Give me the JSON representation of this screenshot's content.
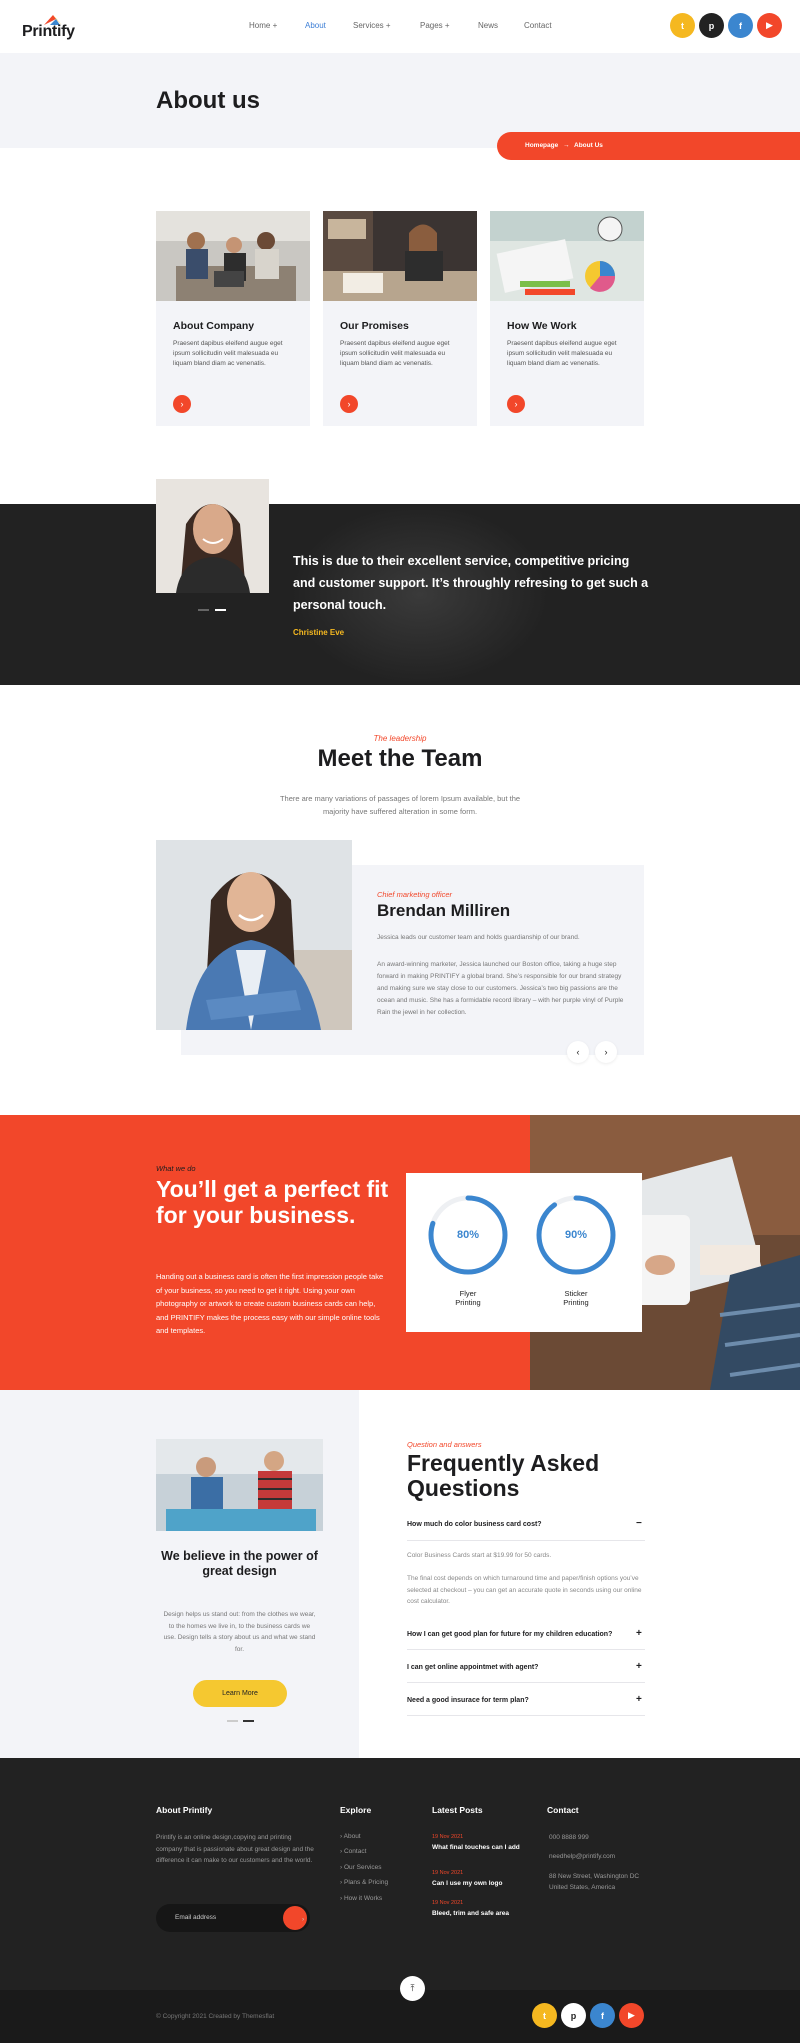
{
  "brand": {
    "name": "Printify"
  },
  "nav": [
    {
      "label": "Home +"
    },
    {
      "label": "About"
    },
    {
      "label": "Services +"
    },
    {
      "label": "Pages +"
    },
    {
      "label": "News"
    },
    {
      "label": "Contact"
    }
  ],
  "colors": {
    "accent": "#f2472a",
    "yellow": "#f5c830",
    "blue": "#3b86cf",
    "dark": "#222222",
    "light": "#f3f4f8"
  },
  "header_social": [
    {
      "icon": "twitter-icon",
      "glyph": "t",
      "color": "#f5b820"
    },
    {
      "icon": "pinterest-icon",
      "glyph": "p",
      "color": "#222222"
    },
    {
      "icon": "facebook-icon",
      "glyph": "f",
      "color": "#3b86cf"
    },
    {
      "icon": "youtube-icon",
      "glyph": "▶",
      "color": "#f2472a"
    }
  ],
  "hero": {
    "title": "About us",
    "breadcrumb": {
      "home": "Homepage",
      "sep": "→",
      "current": "About Us"
    }
  },
  "cards": [
    {
      "title": "About Company",
      "text": "Praesent dapibus eleifend augue eget ipsum sollicitudin velit malesuada eu liquam bland diam ac venenatis."
    },
    {
      "title": "Our Promises",
      "text": "Praesent dapibus eleifend augue eget ipsum sollicitudin velit malesuada eu liquam bland diam ac venenatis."
    },
    {
      "title": "How We Work",
      "text": "Praesent dapibus eleifend augue eget ipsum sollicitudin velit malesuada eu liquam bland diam ac venenatis."
    }
  ],
  "testimonial": {
    "quote": "This is due to their excellent service, competitive pricing and customer support. It’s throughly refresing to get such a personal touch.",
    "author": "Christine Eve"
  },
  "team": {
    "eyebrow": "The leadership",
    "title": "Meet the Team",
    "text": "There are many variations of passages of lorem Ipsum available, but the majority have suffered alteration in some form.",
    "member": {
      "role": "Chief marketing officer",
      "name": "Brendan Milliren",
      "short": "Jessica leads our customer team and holds guardianship of our brand.",
      "bio": "An award-winning marketer, Jessica launched our Boston office, taking a huge step forward in making PRINTIFY a global brand. She’s responsible for our brand strategy and making sure we stay close to our customers. Jessica’s two big passions are the ocean and music. She has a formidable record library – with her purple vinyl of Purple Rain the jewel in her collection."
    }
  },
  "what_we_do": {
    "eyebrow": "What we do",
    "title": "You’ll get a perfect fit for your business.",
    "text": "Handing out a business card is often the first impression people take of your business, so you need to get it right. Using your own photography or artwork to create custom business cards can help, and PRINTIFY makes the process easy with our simple online tools and templates.",
    "progress": [
      {
        "value_label": "80%",
        "value": 0.8,
        "line1": "Flyer",
        "line2": "Printing"
      },
      {
        "value_label": "90%",
        "value": 0.9,
        "line1": "Sticker",
        "line2": "Printing"
      }
    ]
  },
  "believe": {
    "title": "We believe in the power of great design",
    "text": "Design helps us stand out: from the clothes we wear, to the homes we live in, to the business cards we use. Design tells a story about us and what we stand for.",
    "button": "Learn More"
  },
  "faq": {
    "eyebrow": "Question and answers",
    "title": "Frequently Asked Questions",
    "items": [
      {
        "q": "How much do color business card cost?",
        "icon": "−"
      },
      {
        "q": "How I can get good plan for future for my children education?",
        "icon": "+"
      },
      {
        "q": "I can get online appointmet with agent?",
        "icon": "+"
      },
      {
        "q": "Need a good insurace for term plan?",
        "icon": "+"
      }
    ],
    "answer1": "Color Business Cards start at $19.99 for 50 cards.",
    "answer2": "The final cost depends on which turnaround time and paper/finish options you’ve selected at checkout – you can get an accurate quote in seconds using our online cost calculator."
  },
  "footer": {
    "about_title": "About Printify",
    "about_text": "Printify is an online design,copying and printing company that is passionate about great design and the difference it can make to our customers and the world.",
    "email_placeholder": "Email address",
    "explore_title": "Explore",
    "explore": [
      "About",
      "Contact",
      "Our Services",
      "Plans & Pricing",
      "How it Works"
    ],
    "posts_title": "Latest Posts",
    "posts": [
      {
        "date": "19 Nov 2021",
        "title": "What final touches can I add"
      },
      {
        "date": "19 Nov 2021",
        "title": "Can I use my own logo"
      },
      {
        "date": "19 Nov 2021",
        "title": "Bleed, trim and safe area"
      }
    ],
    "contact_title": "Contact",
    "phone": "000 8888 999",
    "email": "needhelp@printify.com",
    "address": "88 New Street, Washington DC United States, America",
    "copyright": "© Copyright 2021 Created by Themesflat",
    "up_glyph": "⤒"
  },
  "footer_social": [
    {
      "icon": "twitter-icon",
      "glyph": "t",
      "color": "#f5b820"
    },
    {
      "icon": "pinterest-icon",
      "glyph": "p",
      "color": "#ffffff"
    },
    {
      "icon": "facebook-icon",
      "glyph": "f",
      "color": "#3b86cf"
    },
    {
      "icon": "youtube-icon",
      "glyph": "▶",
      "color": "#f2472a"
    }
  ]
}
